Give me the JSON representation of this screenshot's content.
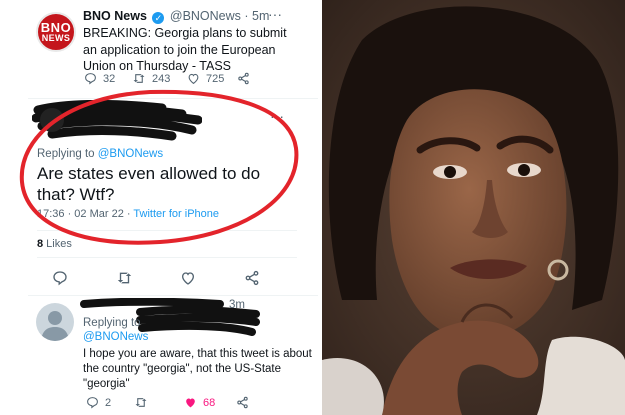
{
  "tweet1": {
    "avatar_line1": "BNO",
    "avatar_line2": "NEWS",
    "name": "BNO News",
    "handle": "@BNONews",
    "time": "· 5m",
    "text": "BREAKING: Georgia plans to submit an application to join the European Union on Thursday - TASS",
    "replies": "32",
    "retweets": "243",
    "likes": "725"
  },
  "tweet2": {
    "replying_prefix": "Replying to",
    "replying_handle": "@BNONews",
    "text": "Are states even allowed to do that? Wtf?",
    "timestamp": "17:36 · 02 Mar 22 · ",
    "source": "Twitter for iPhone",
    "likes_count": "8",
    "likes_label": " Likes"
  },
  "tweet3": {
    "time": "3m",
    "replying_prefix": "Replying to",
    "replying_handle": "@BNONews",
    "text": "I hope you are aware, that this tweet is about the country \"georgia\", not the US-State \"georgia\"",
    "replies": "2",
    "likes": "68"
  },
  "colors": {
    "accent": "#1d9bf0",
    "annotation_red": "#e3242b",
    "like_pink": "#f91880",
    "bno_red": "#c4161c"
  }
}
